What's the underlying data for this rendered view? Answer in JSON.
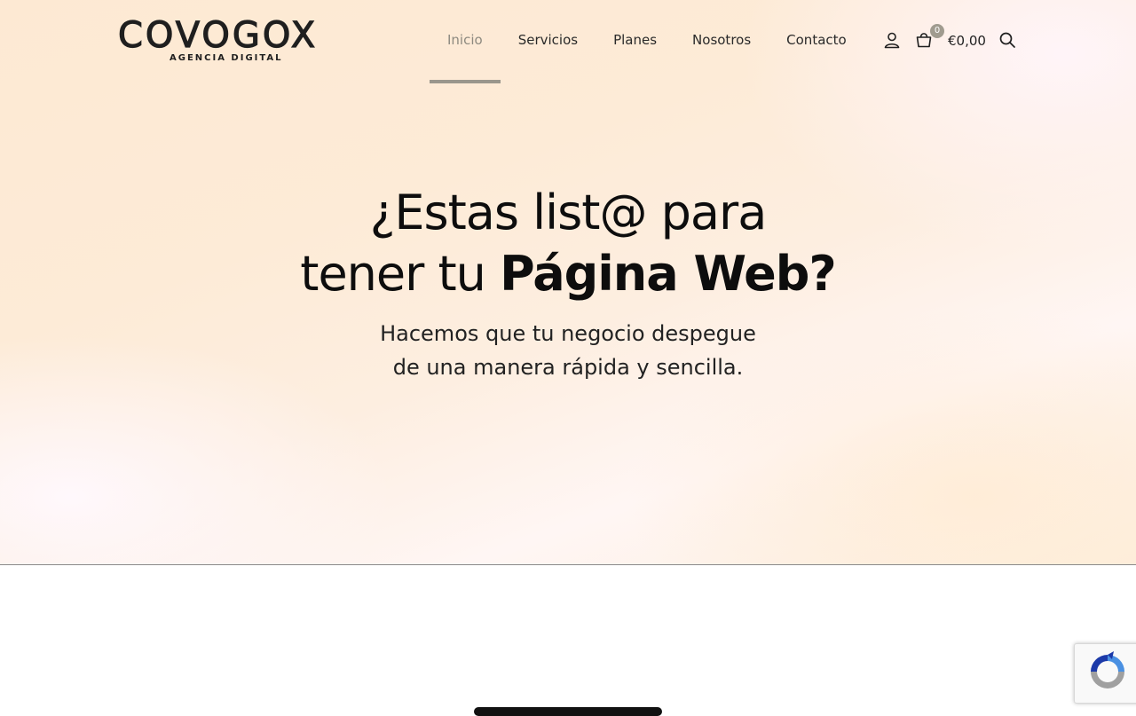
{
  "brand": {
    "name": "COVOGOX",
    "tagline": "AGENCIA DIGITAL"
  },
  "nav": {
    "items": [
      {
        "label": "Inicio",
        "active": true
      },
      {
        "label": "Servicios",
        "active": false
      },
      {
        "label": "Planes",
        "active": false
      },
      {
        "label": "Nosotros",
        "active": false
      },
      {
        "label": "Contacto",
        "active": false
      }
    ]
  },
  "header_actions": {
    "user_icon": "user-icon",
    "cart_icon": "bag-icon",
    "cart_count": "0",
    "cart_total": "€0,00",
    "search_icon": "search-icon"
  },
  "hero": {
    "line1": "¿Estas list@ para",
    "line2_plain": "tener tu ",
    "line2_bold": "Página Web?",
    "sub_line1": "Hacemos que tu negocio despegue",
    "sub_line2": "de una manera rápida y sencilla."
  },
  "widgets": {
    "recaptcha_icon": "recaptcha-icon"
  },
  "colors": {
    "accent": "#9a968c",
    "text": "#111111",
    "hero_bg": "#fdebd7"
  }
}
